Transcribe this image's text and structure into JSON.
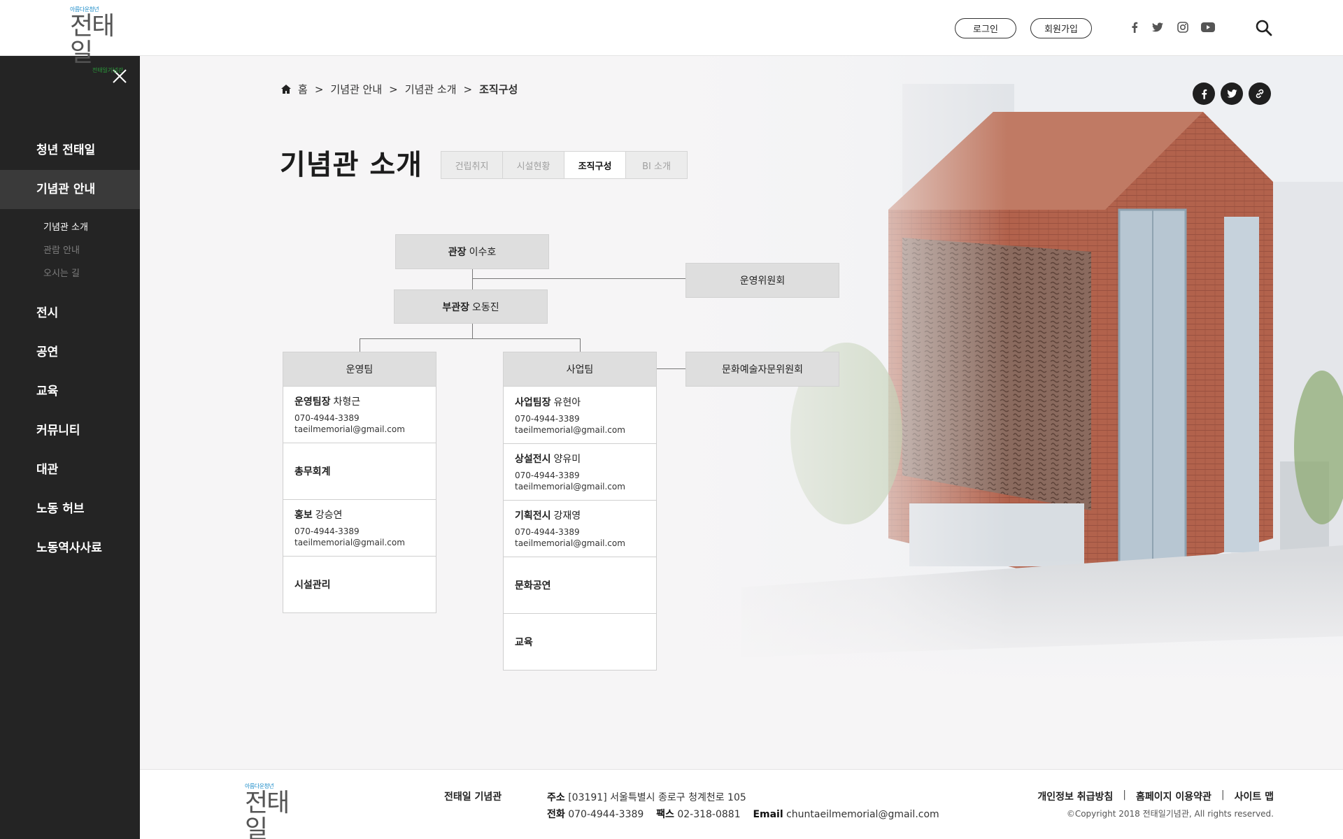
{
  "header": {
    "logo": {
      "small": "아름다운청년",
      "big": "전태일",
      "sub": "전태일기념관"
    },
    "login_label": "로그인",
    "join_label": "회원가입",
    "sns": [
      "facebook-icon",
      "twitter-icon",
      "instagram-icon",
      "youtube-icon"
    ]
  },
  "sidebar": {
    "items": [
      {
        "label": "청년 전태일"
      },
      {
        "label": "기념관 안내"
      },
      {
        "label": "전시"
      },
      {
        "label": "공연"
      },
      {
        "label": "교육"
      },
      {
        "label": "커뮤니티"
      },
      {
        "label": "대관"
      },
      {
        "label": "노동 허브"
      },
      {
        "label": "노동역사사료"
      }
    ],
    "active_index": 1,
    "sub_items": [
      {
        "label": "기념관 소개"
      },
      {
        "label": "관람 안내"
      },
      {
        "label": "오시는 길"
      }
    ]
  },
  "breadcrumb": {
    "home": "홈",
    "sep": ">",
    "items": [
      "기념관 안내",
      "기념관 소개",
      "조직구성"
    ]
  },
  "page": {
    "title": "기념관 소개",
    "tabs": [
      {
        "label": "건립취지"
      },
      {
        "label": "시설현황"
      },
      {
        "label": "조직구성"
      },
      {
        "label": "BI 소개"
      }
    ],
    "active_tab": 2
  },
  "org": {
    "director": {
      "role": "관장",
      "name": "이수호"
    },
    "vice_director": {
      "role": "부관장",
      "name": "오동진"
    },
    "committee1": "운영위원회",
    "committee2": "문화예술자문위원회",
    "team1": {
      "name": "운영팀",
      "members": [
        {
          "role": "운영팀장",
          "name": "차형근",
          "phone": "070-4944-3389",
          "email": "taeilmemorial@gmail.com"
        },
        {
          "role": "총무회계",
          "name": "",
          "phone": "",
          "email": ""
        },
        {
          "role": "홍보",
          "name": "강승연",
          "phone": "070-4944-3389",
          "email": "taeilmemorial@gmail.com"
        },
        {
          "role": "시설관리",
          "name": "",
          "phone": "",
          "email": ""
        }
      ]
    },
    "team2": {
      "name": "사업팀",
      "members": [
        {
          "role": "사업팀장",
          "name": "유현아",
          "phone": "070-4944-3389",
          "email": "taeilmemorial@gmail.com"
        },
        {
          "role": "상설전시",
          "name": "양유미",
          "phone": "070-4944-3389",
          "email": "taeilmemorial@gmail.com"
        },
        {
          "role": "기획전시",
          "name": "강재영",
          "phone": "070-4944-3389",
          "email": "taeilmemorial@gmail.com"
        },
        {
          "role": "문화공연",
          "name": "",
          "phone": "",
          "email": ""
        },
        {
          "role": "교육",
          "name": "",
          "phone": "",
          "email": ""
        }
      ]
    }
  },
  "footer": {
    "name": "전태일 기념관",
    "address_label": "주소",
    "address": "[03191] 서울특별시 종로구 청계천로 105",
    "phone_label": "전화",
    "phone": "070-4944-3389",
    "fax_label": "팩스",
    "fax": "02-318-0881",
    "email_label": "Email",
    "email": "chuntaeilmemorial@gmail.com",
    "links": [
      "개인정보 취급방침",
      "홈페이지 이용약관",
      "사이트 맵"
    ],
    "copyright": "©Copyright 2018 전태일기념관, All rights reserved."
  },
  "colors": {
    "sidebar_bg": "#242424",
    "box_bg": "#dedede",
    "logo_blue": "#1a8bc8",
    "logo_green": "#2a9a3a"
  }
}
